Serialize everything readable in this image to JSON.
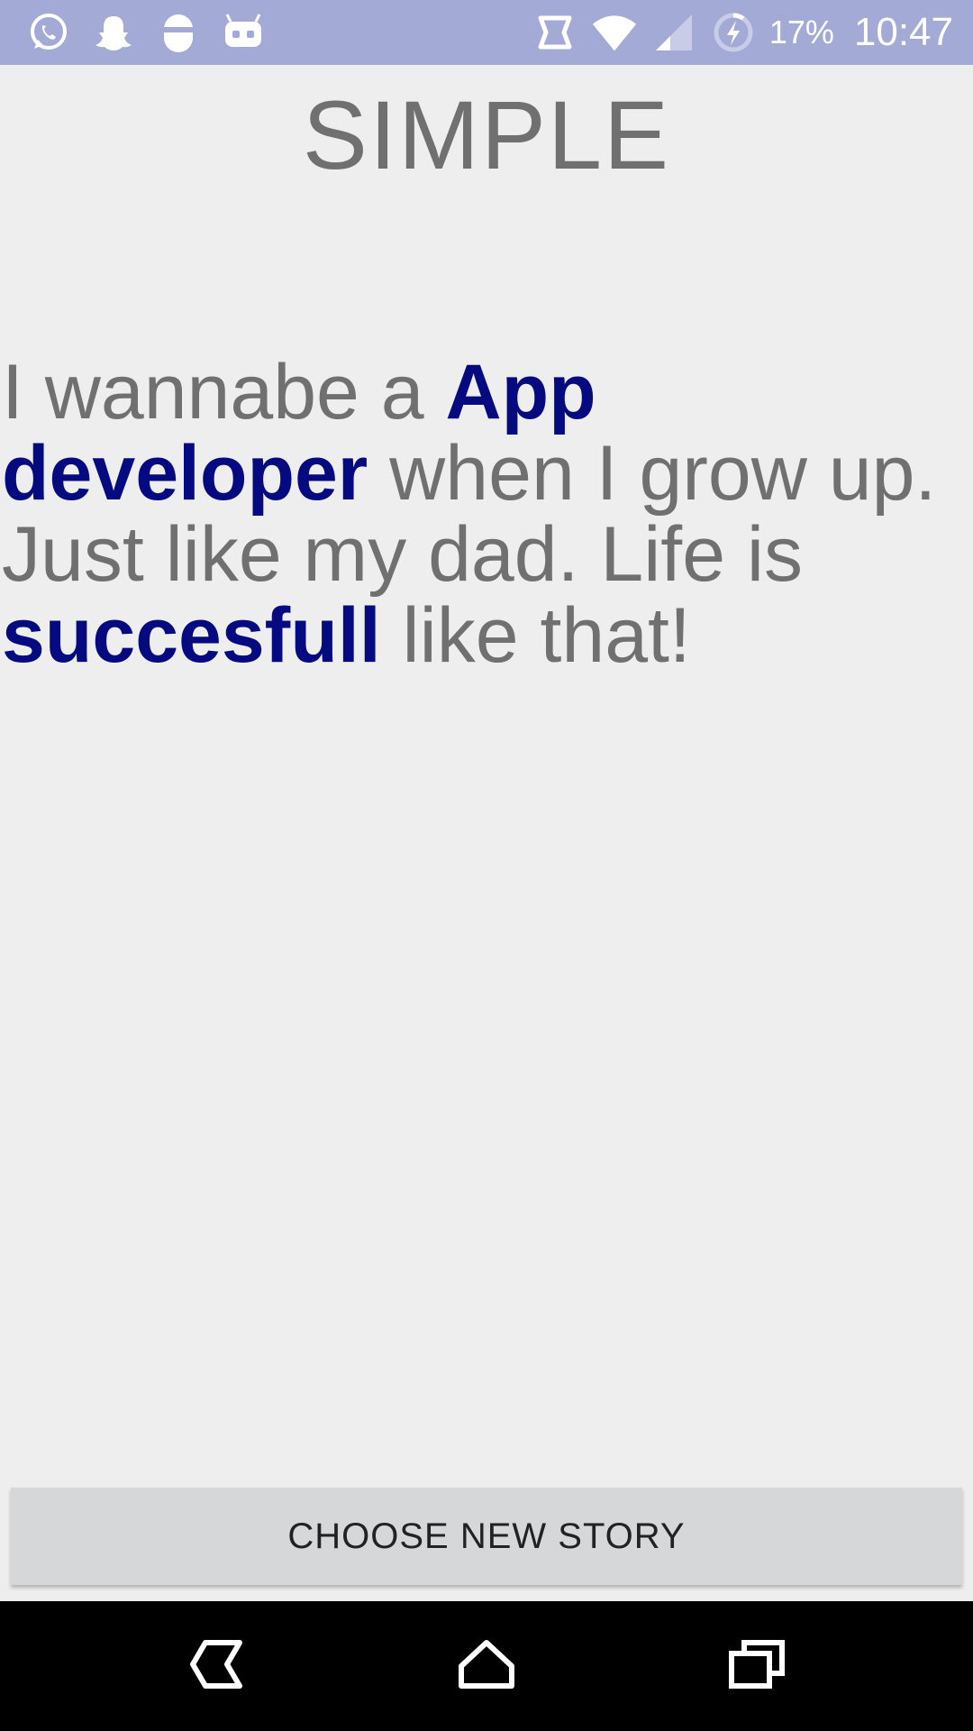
{
  "status_bar": {
    "left_icons": [
      "whatsapp-icon",
      "snapchat-icon",
      "app-icon",
      "cyanogen-icon"
    ],
    "battery_percent": "17%",
    "time": "10:47",
    "background": "#a3aad5"
  },
  "page": {
    "title": "SIMPLE",
    "story": {
      "part1": "I wannabe a ",
      "highlight1": "App developer",
      "part2": " when I grow up. Just like my dad. Life is ",
      "highlight2": "succesfull",
      "part3": " like that!",
      "highlight_color": "#050a80"
    },
    "choose_button_label": "CHOOSE NEW STORY"
  },
  "nav_bar": {
    "icons": [
      "back-icon",
      "home-icon",
      "recents-icon"
    ]
  }
}
